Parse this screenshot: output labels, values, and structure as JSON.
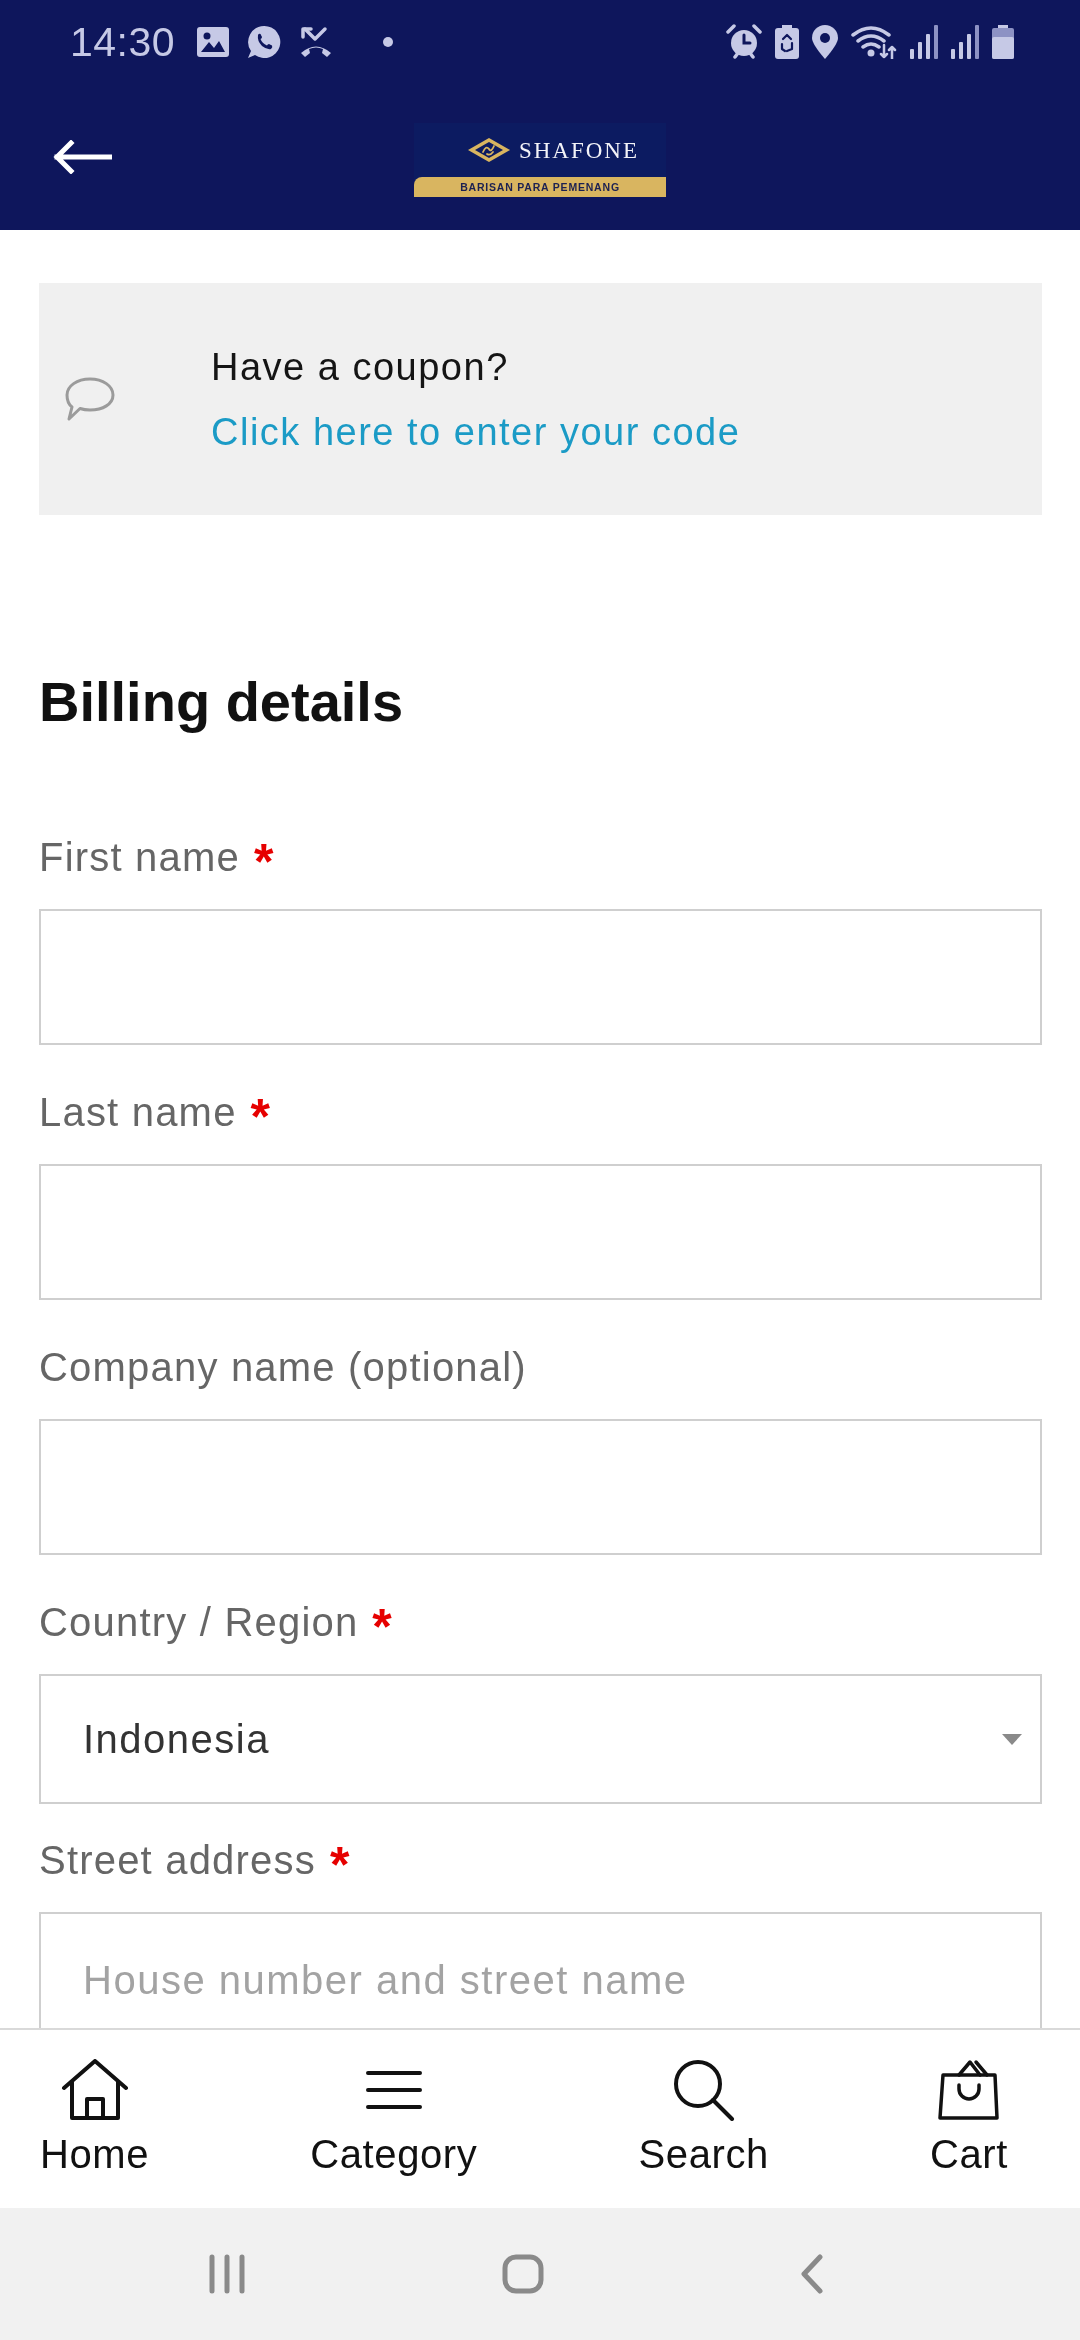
{
  "status_bar": {
    "time": "14:30"
  },
  "header": {
    "logo": {
      "wordmark": "SHAFONE",
      "tagline": "BARISAN PARA PEMENANG"
    }
  },
  "coupon": {
    "prompt": "Have a coupon?",
    "link": "Click here to enter your code"
  },
  "billing": {
    "heading": "Billing details",
    "fields": [
      {
        "kind": "text",
        "label": "First name",
        "required_mark": "*"
      },
      {
        "kind": "text",
        "label": "Last name",
        "required_mark": "*"
      },
      {
        "kind": "text",
        "label": "Company name (optional)"
      },
      {
        "kind": "select",
        "label": "Country / Region",
        "required_mark": "*",
        "value": "Indonesia"
      },
      {
        "kind": "text",
        "label": "Street address",
        "required_mark": "*",
        "placeholder": "House number and street name"
      }
    ]
  },
  "bottom_nav": [
    {
      "kind": "home",
      "label": "Home",
      "selected": false
    },
    {
      "kind": "category",
      "label": "Category",
      "selected": false
    },
    {
      "kind": "search",
      "label": "Search",
      "selected": false
    },
    {
      "kind": "cart",
      "label": "Cart",
      "selected": false
    }
  ]
}
